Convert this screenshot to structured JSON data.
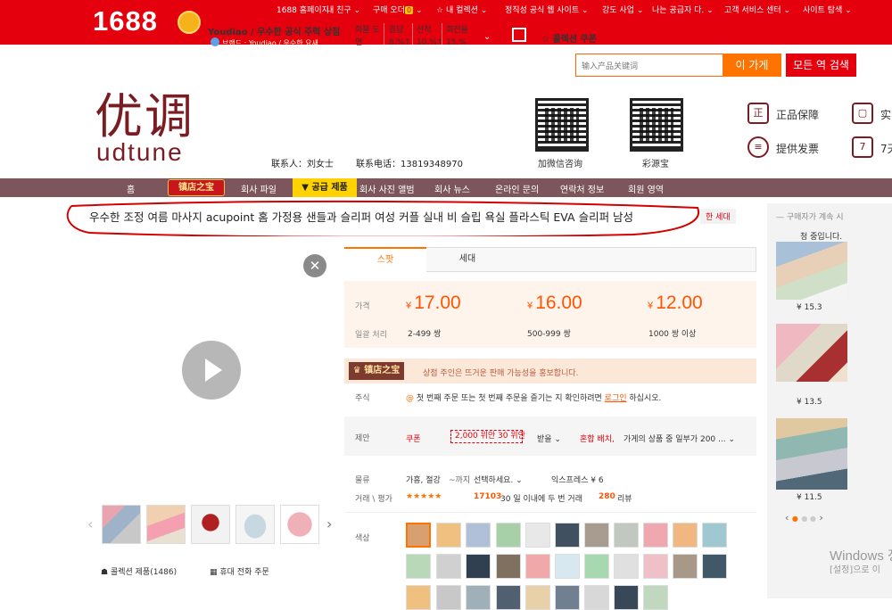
{
  "topbar": {
    "logo": "1688",
    "shop_name": "Youdiao / 우수한 공식 주력 상점",
    "sub_name": "브랜드 : Youdiao / 우수한 요새",
    "stats": [
      {
        "label": "화물 도",
        "value": "면"
      },
      {
        "label": "응답",
        "value": "8.%↑"
      },
      {
        "label": "선적",
        "value": "10.%↑"
      },
      {
        "label": "회전율",
        "value": "15.%"
      }
    ],
    "favorite": "콜렉션 쿠폰",
    "nav": [
      "1688 홈페이지",
      "내 친구",
      "구매 오더",
      "0",
      "내 컬렉션",
      "정직성 공식 웹 사이트",
      "강도 사업",
      "나는 공급자 다.",
      "고객 서비스 센터",
      "사이트 탐색"
    ]
  },
  "search": {
    "placeholder": "输入产品关键词",
    "btn_this": "이 가게",
    "btn_all": "모든 역 검색"
  },
  "brand": {
    "cn": "优调",
    "en": "udtune",
    "contact_name": "联系人：刘女士",
    "contact_phone": "联系电话：13819348970",
    "qr1": "加微信咨询",
    "qr2": "彩源宝"
  },
  "services": [
    {
      "icon": "正",
      "label": "正品保障"
    },
    {
      "icon": "▢",
      "label": "实"
    },
    {
      "icon": "≡",
      "label": "提供发票"
    },
    {
      "icon": "7",
      "label": "7天"
    }
  ],
  "nav": {
    "home": "홈",
    "hot": "镇店之宝",
    "items": [
      "회사 파일",
      "▼ 공급 제품",
      "회사 사진 앨범",
      "회사 뉴스",
      "온라인 문의",
      "연락처 정보",
      "회원 영역"
    ]
  },
  "product": {
    "title": "우수한 조정 여름 마사지 acupoint 홈 가정용 샌들과 슬리퍼 여성 커플 실내 비 슬립 욕실 플라스틱 EVA 슬리퍼 남성",
    "tag": "한 세대",
    "tabs": [
      "스팟",
      "세대"
    ],
    "price_label": "가격",
    "batch_label": "일괄 처리",
    "prices": [
      {
        "value": "17.00",
        "range": "2-499 쌍"
      },
      {
        "value": "16.00",
        "range": "500-999 쌍"
      },
      {
        "value": "12.00",
        "range": "1000 쌍 이상"
      }
    ],
    "promo_tag": "镇店之宝",
    "promo_text": "상점 주인은 뜨거운 판매 가능성을 홍보합니다.",
    "notice_label": "주식",
    "notice_text": "첫 번째 주문 또는 첫 번째 주문을 즐기는 지 확인하려면",
    "notice_link": "로그인",
    "notice_end": "하십시오.",
    "offer_label": "제안",
    "coupon_label": "쿠폰",
    "coupon_value": "2,000 위안 30 위안",
    "receive": "받을",
    "mix_label": "혼합 배치,",
    "mix_text": "가게의 상품 중 일부가 200 ...",
    "logistics_label": "물류",
    "logistics_from": "가흥, 절강",
    "logistics_to": "~까지",
    "logistics_select": "선택하세요.",
    "logistics_express": "익스프레스 ¥ 6",
    "trade_label": "거래 \\ 평가",
    "stars": "★★★★★",
    "sold": "17103",
    "sold_text": "30 일 이내에 두 번 거래",
    "reviews": "280",
    "reviews_text": "리뷰",
    "color_label": "색상",
    "fav": "콜렉션 제품(1486)",
    "mobile": "휴대 전화 주문"
  },
  "sidebar": {
    "title": "구매자가 계속 시",
    "subtitle": "청 중입니다.",
    "items": [
      "¥ 15.3",
      "¥ 13.5",
      "¥ 11.5"
    ]
  },
  "windows": {
    "line1": "Windows 정",
    "line2": "[설정]으로 이"
  },
  "colors": {
    "red": "#e4000c",
    "orange": "#ff7300",
    "brand": "#7a1d22",
    "nav": "#7c565a"
  }
}
